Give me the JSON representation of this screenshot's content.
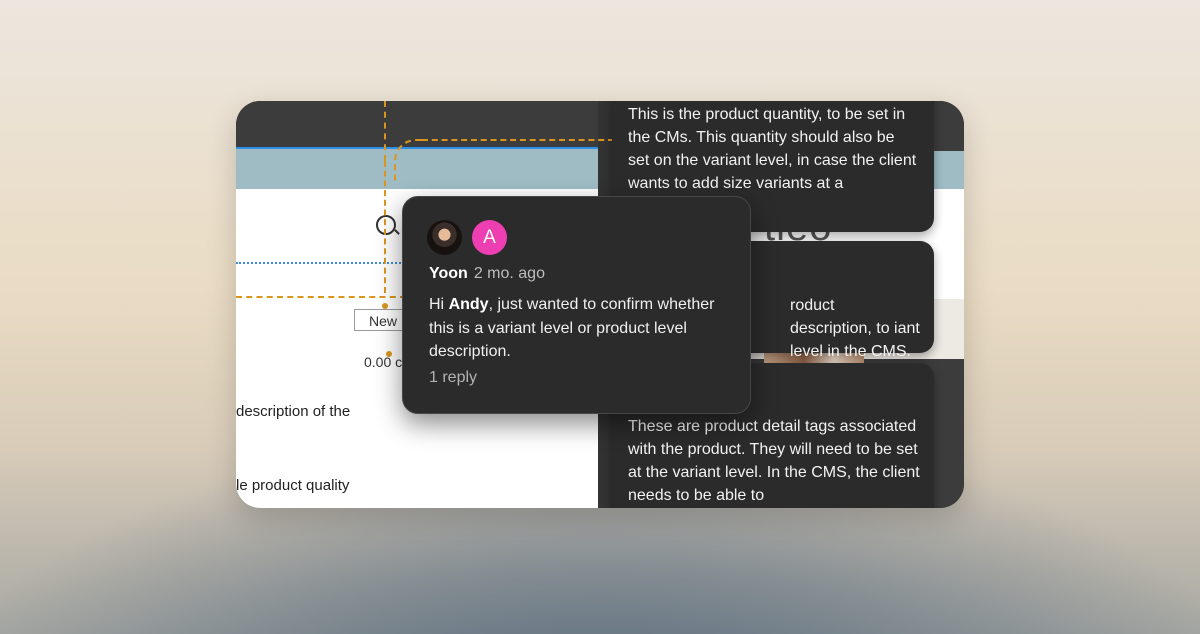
{
  "canvas": {
    "new_button_label": "New",
    "price_fragment": "0.00 c",
    "description_fragment": "description of the",
    "quality_fragment": "le product quality",
    "big_word_fragment": "tieo"
  },
  "notes": [
    {
      "text": "This is the product quantity, to be set in the CMs. This quantity should also be set on the variant level, in case the client wants to add size variants at a"
    },
    {
      "text": "roduct description, to iant level in the CMS."
    },
    {
      "text": "These are product detail tags associated with the product. They will need to be set at the variant level. In the CMS, the client needs to be able to"
    }
  ],
  "comment": {
    "avatar_letter": "A",
    "author": "Yoon",
    "time": "2 mo. ago",
    "body_prefix": "Hi ",
    "mention": "Andy",
    "body_suffix": ", just wanted to confirm whether this is a variant level or product level description.",
    "replies": "1 reply"
  },
  "colors": {
    "accent_pink": "#ee3fb2",
    "selection_blue": "#2d8ee6",
    "connector_orange": "#d9961f"
  }
}
